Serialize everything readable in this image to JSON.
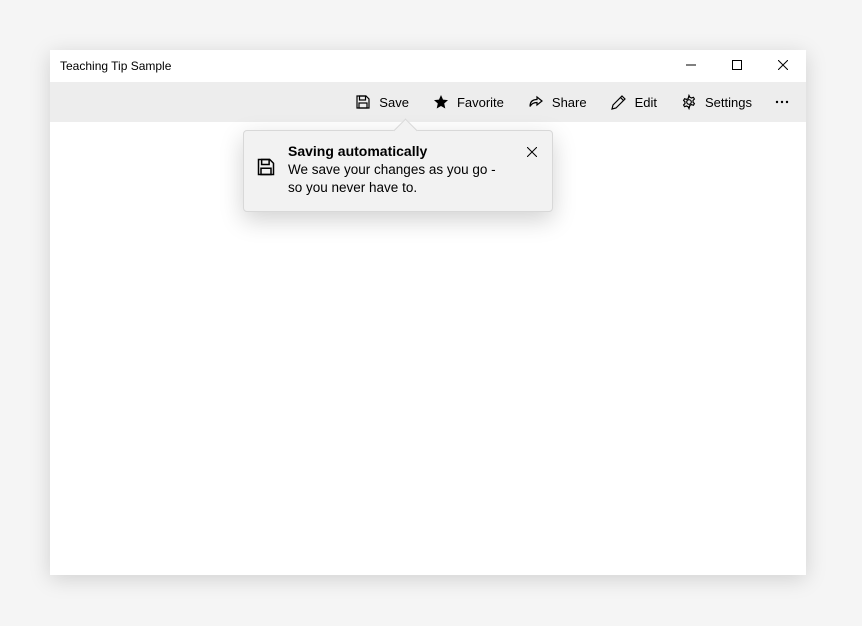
{
  "window": {
    "title": "Teaching Tip Sample"
  },
  "toolbar": {
    "save_label": "Save",
    "favorite_label": "Favorite",
    "share_label": "Share",
    "edit_label": "Edit",
    "settings_label": "Settings"
  },
  "tip": {
    "title": "Saving automatically",
    "body": "We save your changes as you go - so you never have to."
  }
}
